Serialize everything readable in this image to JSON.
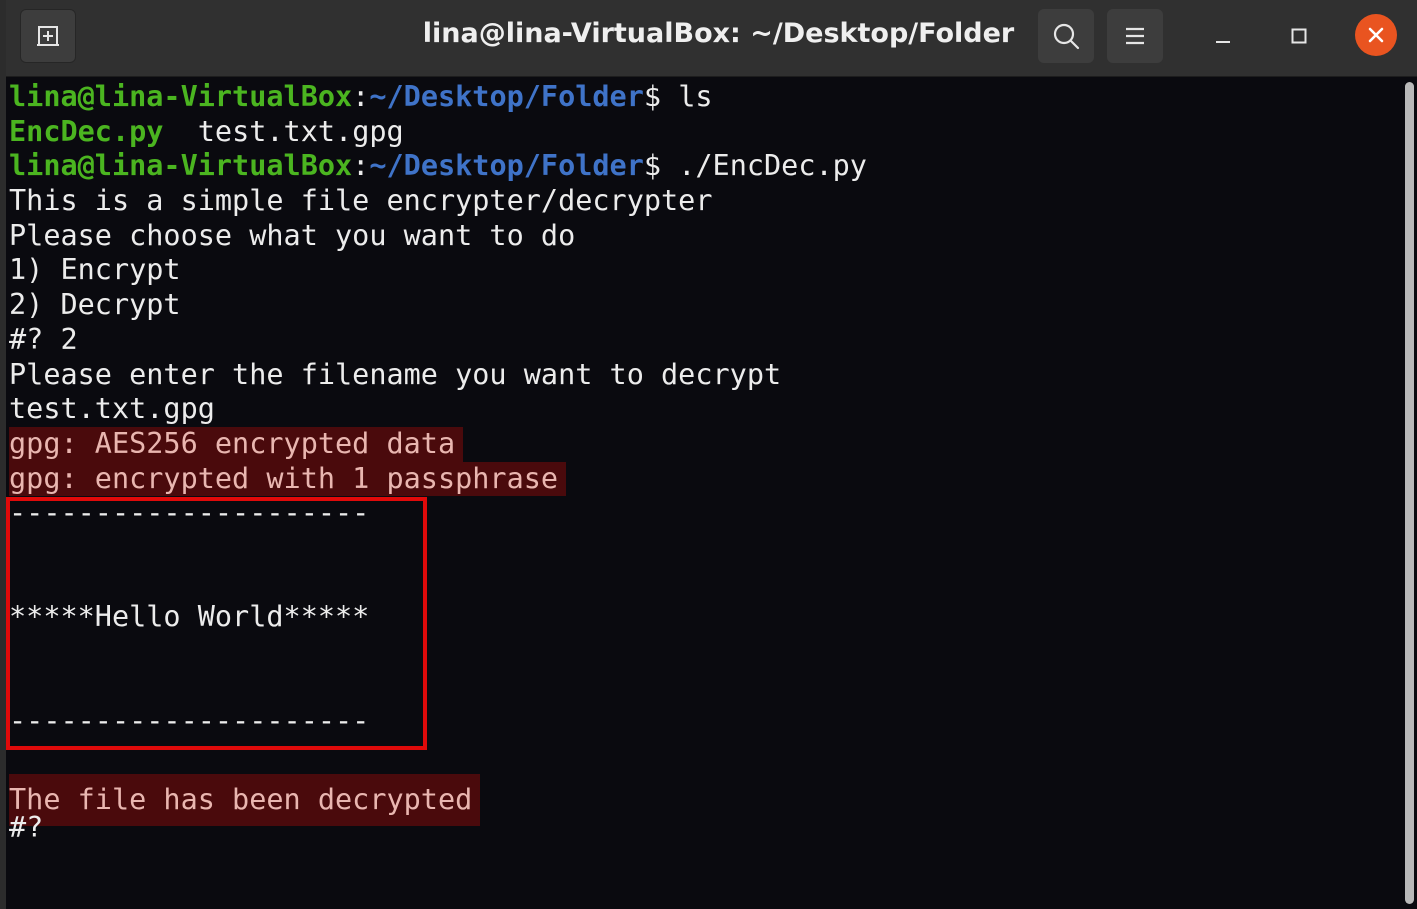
{
  "window": {
    "title": "lina@lina-VirtualBox: ~/Desktop/Folder"
  },
  "titlebar": {
    "new_tab_icon": "new-tab-icon",
    "search_icon": "search-icon",
    "menu_icon": "hamburger-menu-icon",
    "minimize_icon": "minimize-icon",
    "maximize_icon": "maximize-icon",
    "close_icon": "close-icon",
    "close_color": "#e95420"
  },
  "terminal": {
    "colors": {
      "background": "#0a0a0f",
      "user": "#4bb520",
      "path": "#3f73c8",
      "text": "#ececec",
      "highlight_bg": "#4a0a0c",
      "highlight_text": "#e9b6b0",
      "annotation_box": "#e00a0a"
    },
    "prompt1": {
      "user": "lina@lina-VirtualBox",
      "sep": ":",
      "path": "~/Desktop/Folder",
      "dollar": "$",
      "cmd": " ls"
    },
    "ls_output": {
      "file1": "EncDec.py",
      "gap": "  ",
      "file2": "test.txt.gpg"
    },
    "prompt2": {
      "user": "lina@lina-VirtualBox",
      "sep": ":",
      "path": "~/Desktop/Folder",
      "dollar": "$",
      "cmd": " ./EncDec.py"
    },
    "lines": [
      "This is a simple file encrypter/decrypter",
      "Please choose what you want to do",
      "1) Encrypt",
      "2) Decrypt",
      "#? 2",
      "Please enter the filename you want to decrypt",
      "test.txt.gpg"
    ],
    "gpg_lines": [
      "gpg: AES256 encrypted data",
      "gpg: encrypted with 1 passphrase"
    ],
    "content_lines": [
      "---------------------",
      "",
      "",
      "*****Hello World*****",
      "",
      "",
      "---------------------",
      ""
    ],
    "result": "The file has been decrypted",
    "final_prompt": "#?"
  }
}
